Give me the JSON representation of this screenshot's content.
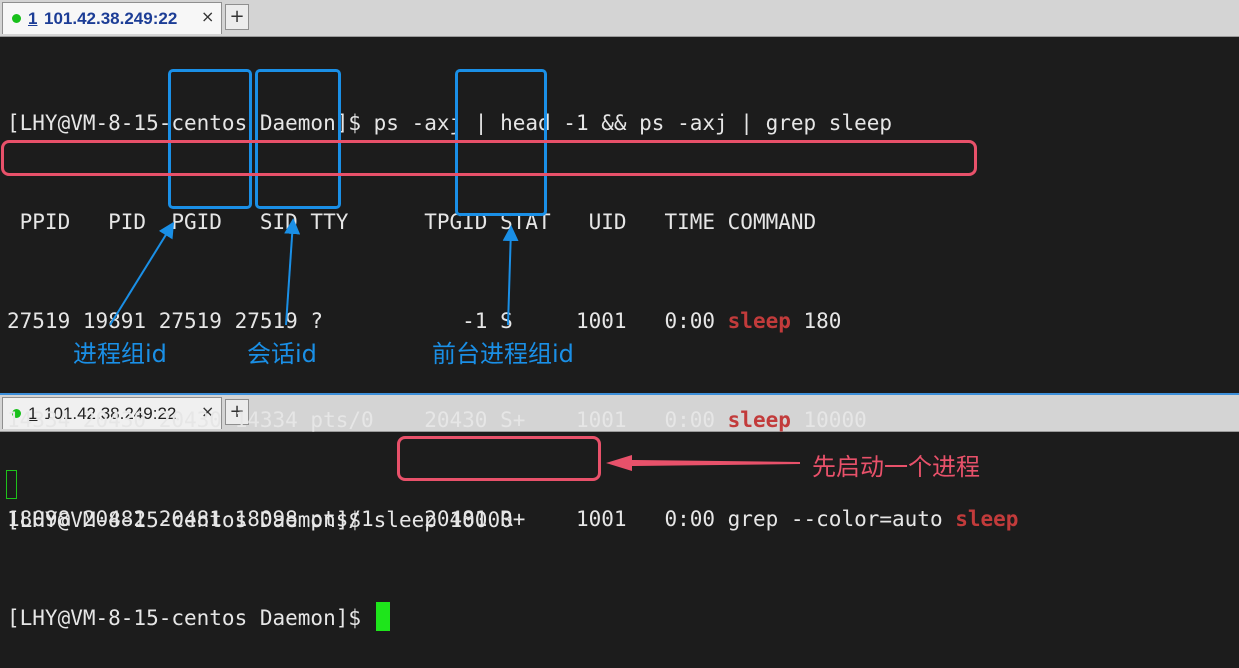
{
  "tab": {
    "status_dot_color": "#18c01b",
    "number": "1",
    "title": "101.42.38.249:22",
    "close_glyph": "×",
    "add_glyph": "+"
  },
  "pane_top": {
    "prompt": "[LHY@VM-8-15-centos Daemon]$ ",
    "command": "ps -axj | head -1 && ps -axj | grep sleep",
    "header": " PPID   PID  PGID   SID TTY      TPGID STAT   UID   TIME COMMAND",
    "rows": [
      {
        "cols": "27519 19891 27519 27519 ?           -1 S     1001   0:00 ",
        "match": "sleep",
        "rest": " 180"
      },
      {
        "cols": "14334 20430 20430 14334 pts/0    20430 S+    1001   0:00 ",
        "match": "sleep",
        "rest": " 10000"
      },
      {
        "cols": "18098 20482 20481 18098 pts/1    20481 R+    1001   0:00 grep --color=auto ",
        "match": "sleep",
        "rest": ""
      }
    ],
    "prompt_end": "[LHY@VM-8-15-centos Daemon]$ "
  },
  "pane_bottom": {
    "prompt": "[LHY@VM-8-15-centos Daemon]$ ",
    "command": "sleep 10000"
  },
  "annotations": {
    "pgid_label": "进程组id",
    "sid_label": "会话id",
    "tpgid_label": "前台进程组id",
    "start_label": "先启动一个进程"
  },
  "colors": {
    "annotation_blue": "#1a8fe6",
    "annotation_red": "#e8516a",
    "grep_match": "#c23b3b",
    "cursor": "#1ee51b",
    "pane_divider": "#3d8fd9"
  },
  "icons": {
    "status": "status-dot-icon",
    "close": "close-icon",
    "add": "add-tab-icon"
  }
}
